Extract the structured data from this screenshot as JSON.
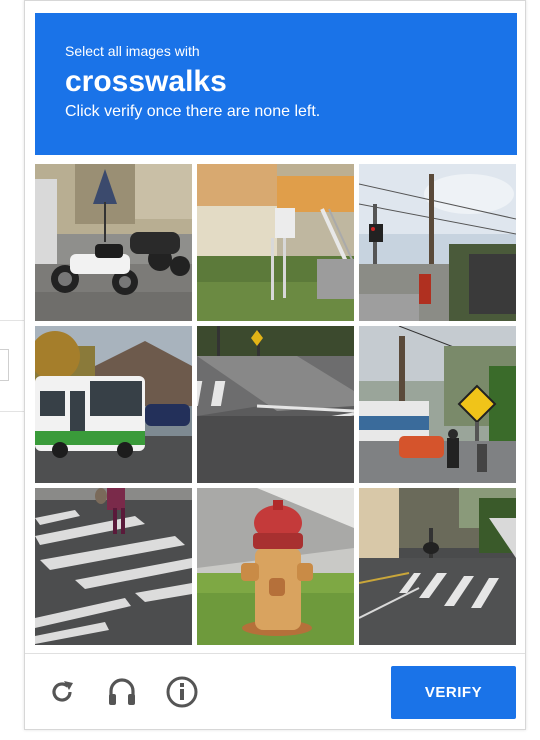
{
  "header": {
    "instruction": "Select all images with",
    "keyword": "crosswalks",
    "subtext": "Click verify once there are none left."
  },
  "tiles": [
    {
      "content": "parked-motorcycles"
    },
    {
      "content": "building-with-sign"
    },
    {
      "content": "traffic-light-pole"
    },
    {
      "content": "bus-on-street"
    },
    {
      "content": "crosswalk-intersection"
    },
    {
      "content": "pedestrian-crossing-sign"
    },
    {
      "content": "crosswalk-with-pedestrian"
    },
    {
      "content": "fire-hydrant"
    },
    {
      "content": "street-with-crosswalk"
    }
  ],
  "footer": {
    "reload_icon": "reload-icon",
    "audio_icon": "headphones-icon",
    "info_icon": "info-icon",
    "verify_label": "VERIFY"
  },
  "colors": {
    "accent": "#1a73e8",
    "icon": "#555555"
  }
}
